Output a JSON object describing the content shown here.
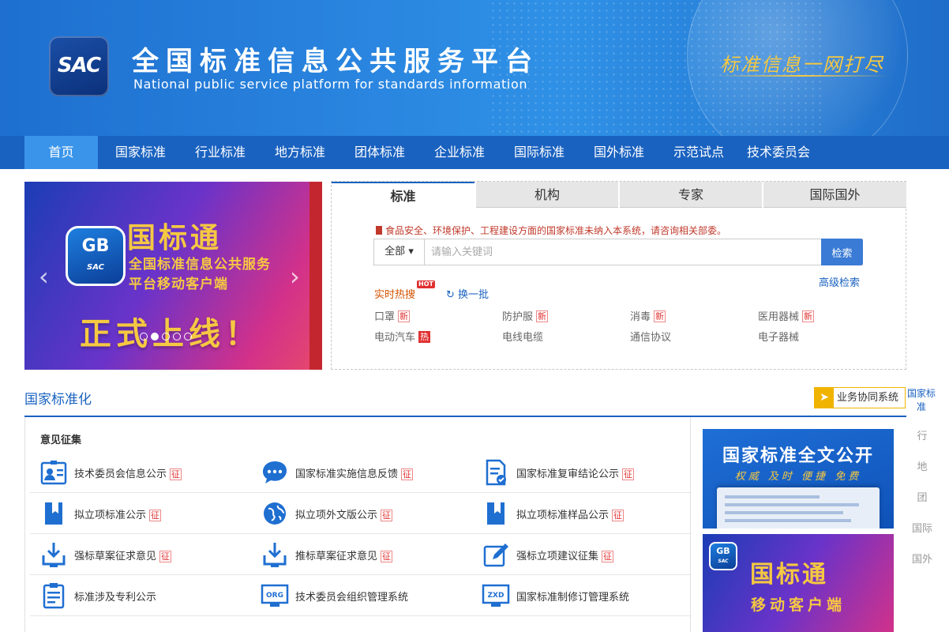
{
  "header": {
    "logo_text": "SAC",
    "title": "全国标准信息公共服务平台",
    "subtitle": "National public service platform  for standards information",
    "slogan": "标准信息一网打尽"
  },
  "nav": {
    "items": [
      {
        "label": "首页",
        "active": true
      },
      {
        "label": "国家标准"
      },
      {
        "label": "行业标准"
      },
      {
        "label": "地方标准"
      },
      {
        "label": "团体标准"
      },
      {
        "label": "企业标准"
      },
      {
        "label": "国际标准"
      },
      {
        "label": "国外标准"
      },
      {
        "label": "示范试点"
      },
      {
        "label": "技术委员会"
      }
    ]
  },
  "banner": {
    "logo_text": "GB",
    "logo_sub": "SAC",
    "title": "国标通",
    "line1": "全国标准信息公共服务",
    "line2": "平台移动客户端",
    "launch": "正式上线！",
    "prev_arrow": "‹",
    "next_arrow": "›",
    "slide_count": 5,
    "active_slide": 2
  },
  "search": {
    "tabs": [
      "标准",
      "机构",
      "专家",
      "国际国外"
    ],
    "active_tab": 0,
    "notice": "食品安全、环境保护、工程建设方面的国家标准未纳入本系统，请咨询相关部委。",
    "scope": "全部",
    "scope_caret": "▾",
    "placeholder": "请输入关键词",
    "search_button": "检索",
    "advanced": "高级检索",
    "hot_label": "实时热搜",
    "hot_badge": "HOT",
    "refresh": "换一批",
    "refresh_icon": "↻",
    "keywords": [
      {
        "text": "口罩",
        "tag": "新",
        "type": "new"
      },
      {
        "text": "防护服",
        "tag": "新",
        "type": "new"
      },
      {
        "text": "消毒",
        "tag": "新",
        "type": "new"
      },
      {
        "text": "医用器械",
        "tag": "新",
        "type": "new"
      },
      {
        "text": "电动汽车",
        "tag": "热",
        "type": "hot"
      },
      {
        "text": "电线电缆",
        "tag": "",
        "type": ""
      },
      {
        "text": "通信协议",
        "tag": "",
        "type": ""
      },
      {
        "text": "电子器械",
        "tag": "",
        "type": ""
      }
    ]
  },
  "section": {
    "title": "国家标准化",
    "biz_button": "业务协同系统",
    "biz_icon": "➤"
  },
  "side_tabs": [
    "国家标准",
    "行",
    "地",
    "团",
    "国际",
    "国外"
  ],
  "opinion": {
    "title": "意见征集",
    "items": [
      {
        "label": "技术委员会信息公示",
        "tag": "征",
        "icon": "committee-card-icon"
      },
      {
        "label": "国家标准实施信息反馈",
        "tag": "征",
        "icon": "chat-bubble-icon"
      },
      {
        "label": "国家标准复审结论公示",
        "tag": "征",
        "icon": "document-review-icon"
      },
      {
        "label": "拟立项标准公示",
        "tag": "征",
        "icon": "bookmark-icon"
      },
      {
        "label": "拟立项外文版公示",
        "tag": "征",
        "icon": "globe-icon"
      },
      {
        "label": "拟立项标准样品公示",
        "tag": "征",
        "icon": "bookmark-icon"
      },
      {
        "label": "强标草案征求意见",
        "tag": "征",
        "icon": "download-tray-icon"
      },
      {
        "label": "推标草案征求意见",
        "tag": "征",
        "icon": "download-tray-icon"
      },
      {
        "label": "强标立项建议征集",
        "tag": "征",
        "icon": "edit-icon"
      },
      {
        "label": "标准涉及专利公示",
        "tag": "",
        "icon": "patent-doc-icon"
      },
      {
        "label": "技术委员会组织管理系统",
        "tag": "",
        "icon": "org-monitor-icon",
        "icon_text": "ORG"
      },
      {
        "label": "国家标准制修订管理系统",
        "tag": "",
        "icon": "zxd-monitor-icon",
        "icon_text": "ZXD"
      }
    ]
  },
  "promos": {
    "fulltext_title": "国家标准全文公开",
    "fulltext_sub": "权威 及时 便捷 免费",
    "app_title": "国标通",
    "app_sub": "移动客户端",
    "app_logo": "GB",
    "app_logo_sub": "SAC"
  },
  "colors": {
    "primary": "#1a62c0",
    "nav_active": "#3a95ea",
    "accent_gold": "#f5c842",
    "tag_red": "#e03030",
    "icon_blue": "#1f6fd1"
  }
}
